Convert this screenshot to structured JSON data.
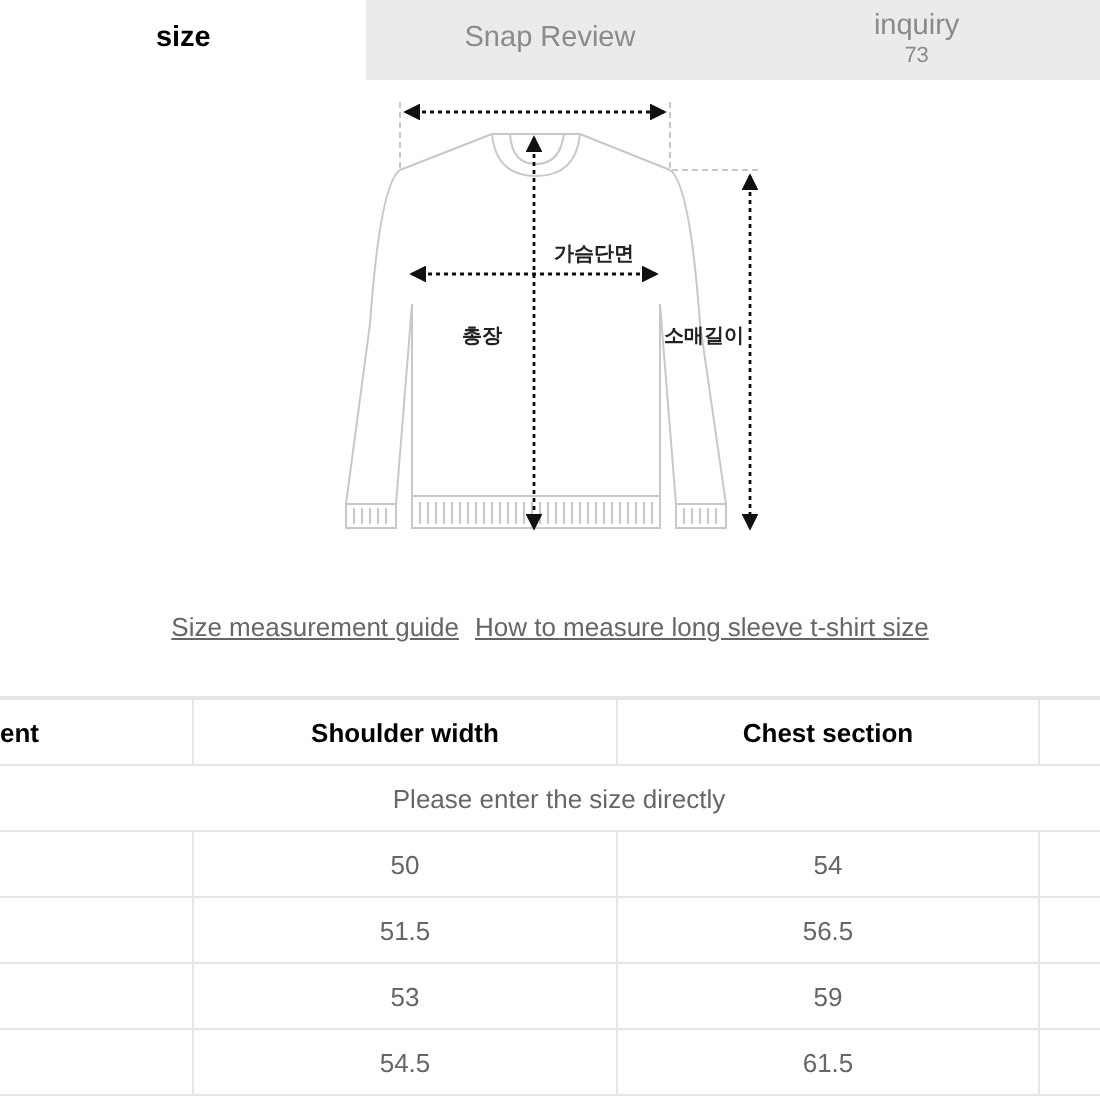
{
  "tabs": [
    {
      "label": "size",
      "selected": true
    },
    {
      "label": "Snap Review",
      "selected": false
    },
    {
      "label": "inquiry",
      "count": "73",
      "selected": false
    }
  ],
  "diagram": {
    "labels": {
      "chest": "가슴단면",
      "length": "총장",
      "sleeve": "소매길이"
    }
  },
  "links": [
    "Size measurement guide",
    "How to measure long sleeve t-shirt size"
  ],
  "table": {
    "columns": [
      "ent",
      "Shoulder width",
      "Chest section",
      ""
    ],
    "notice": "Please enter the size directly",
    "rows": [
      [
        "",
        "50",
        "54"
      ],
      [
        "",
        "51.5",
        "56.5"
      ],
      [
        "",
        "53",
        "59"
      ],
      [
        "",
        "54.5",
        "61.5"
      ]
    ]
  }
}
